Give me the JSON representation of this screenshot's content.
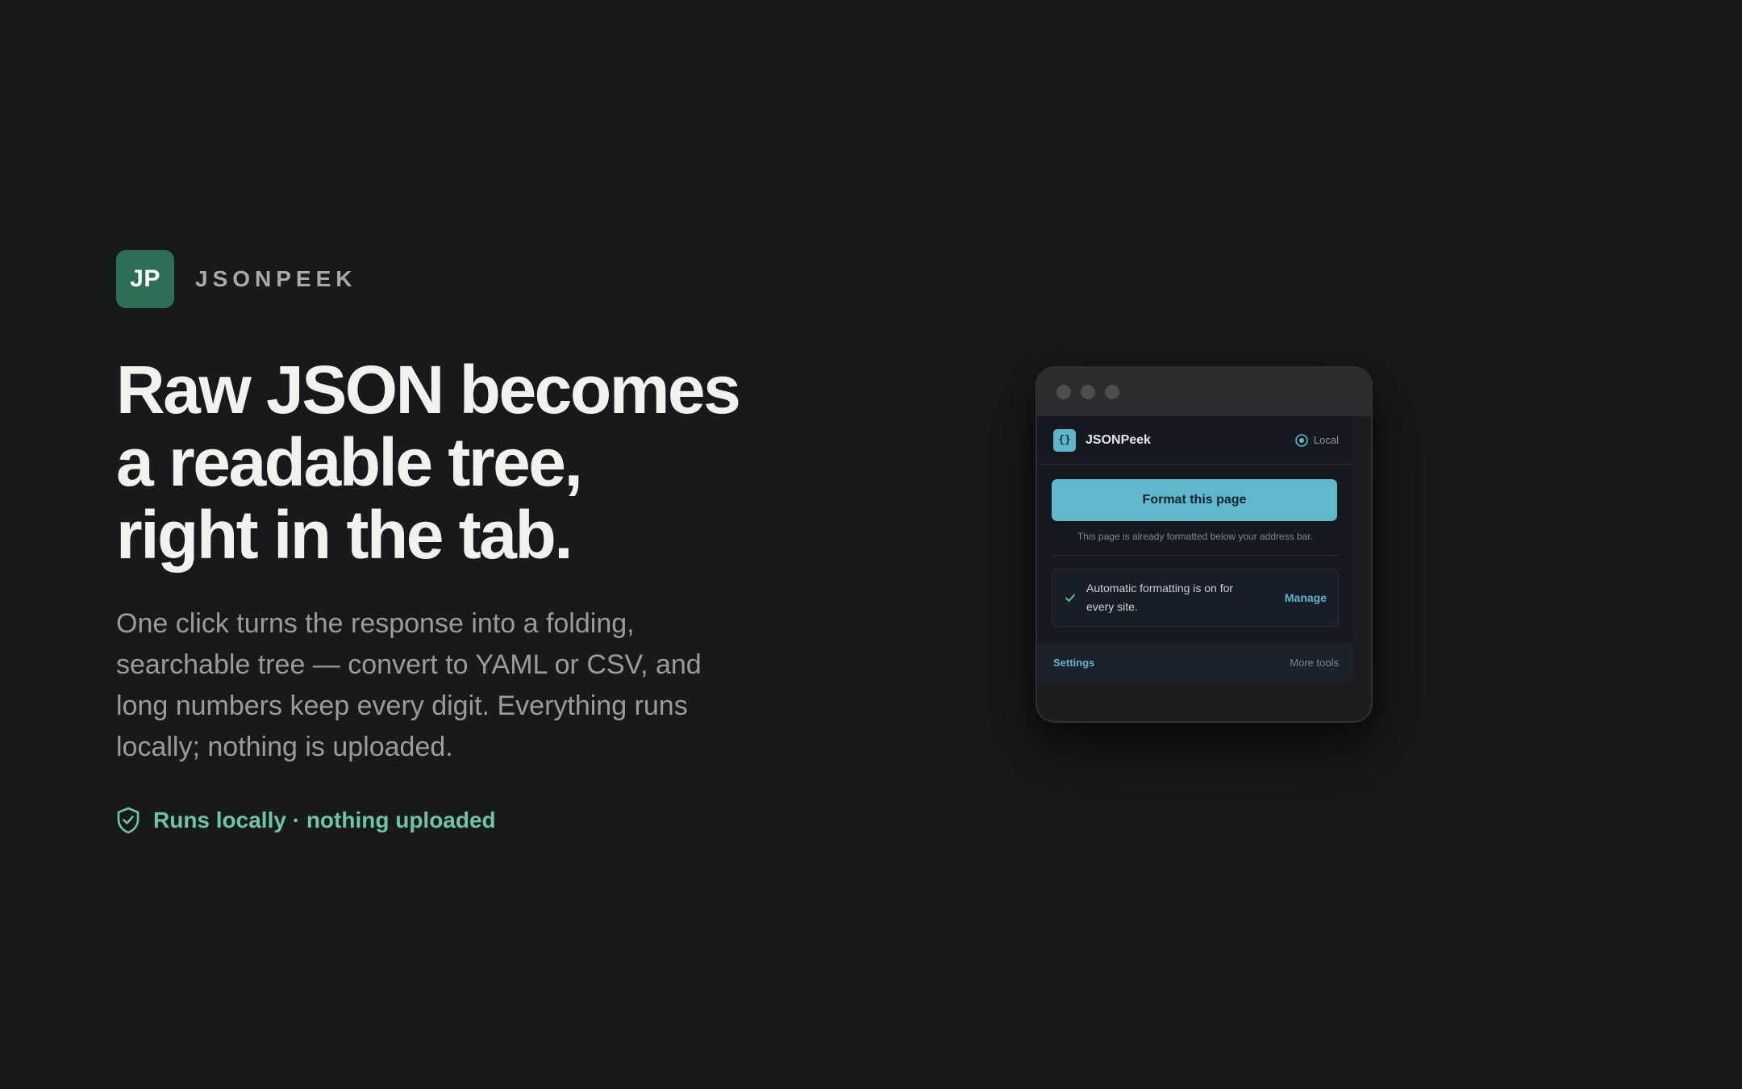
{
  "brand": {
    "badge": "JP",
    "name": "JSONPEEK"
  },
  "hero": {
    "headline_lines": [
      "Raw JSON becomes",
      "a readable tree,",
      "right in the tab."
    ],
    "lede": "One click turns the response into a folding, searchable tree — convert to YAML or CSV, and long numbers keep every digit. Everything runs locally; nothing is uploaded.",
    "trust": {
      "icon": "shield-check-icon",
      "text": "Runs locally · nothing uploaded"
    }
  },
  "popup": {
    "window_dots": 3,
    "header": {
      "icon": "{}",
      "title": "JSONPeek",
      "status": "Local",
      "status_icon": "radio-dot-icon"
    },
    "primary_button": "Format this page",
    "note": "This page is already formatted below your address bar.",
    "auto_card": {
      "icon": "check-icon",
      "text": "Automatic formatting is on for every site.",
      "action": "Manage"
    },
    "footer": {
      "left": "Settings",
      "right": "More tools"
    }
  },
  "colors": {
    "background": "#18191b",
    "brand_badge": "#2d6e55",
    "accent": "#60b7cc",
    "trust_green": "#6fc3a8"
  }
}
